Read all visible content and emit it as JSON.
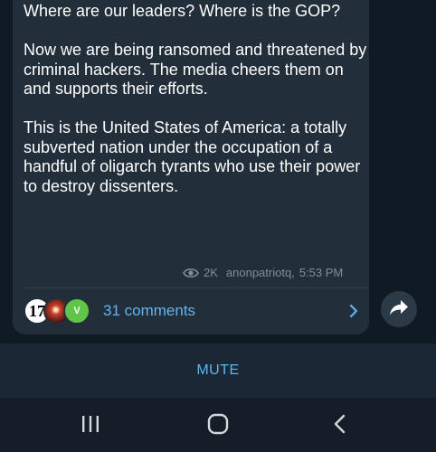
{
  "message": {
    "paragraphs": [
      "Where are our leaders? Where is the GOP?",
      "Now we are being ransomed and threatened by criminal hackers. The media cheers them on and supports their efforts.",
      "This is the United States of America: a totally subverted nation under the occupation of a handful of oligarch tyrants who use their power to destroy dissenters."
    ],
    "views": "2K",
    "author": "anonpatriotq,",
    "time": "5:53 PM"
  },
  "comments": {
    "avatars": [
      {
        "name": "avatar-17",
        "text": "17"
      },
      {
        "name": "avatar-sunset",
        "text": ""
      },
      {
        "name": "avatar-v",
        "text": "V"
      }
    ],
    "label": "31 comments"
  },
  "mute": {
    "label": "MUTE"
  },
  "icons": {
    "views": "eye-icon",
    "comments_arrow": "chevron-right-icon",
    "share": "share-arrow-icon",
    "nav_recents": "recents-icon",
    "nav_home": "home-icon",
    "nav_back": "back-icon"
  },
  "colors": {
    "bubble": "#222f3b",
    "accent": "#62b3f2",
    "background": "#0f1a24",
    "bar": "#1b2734"
  }
}
